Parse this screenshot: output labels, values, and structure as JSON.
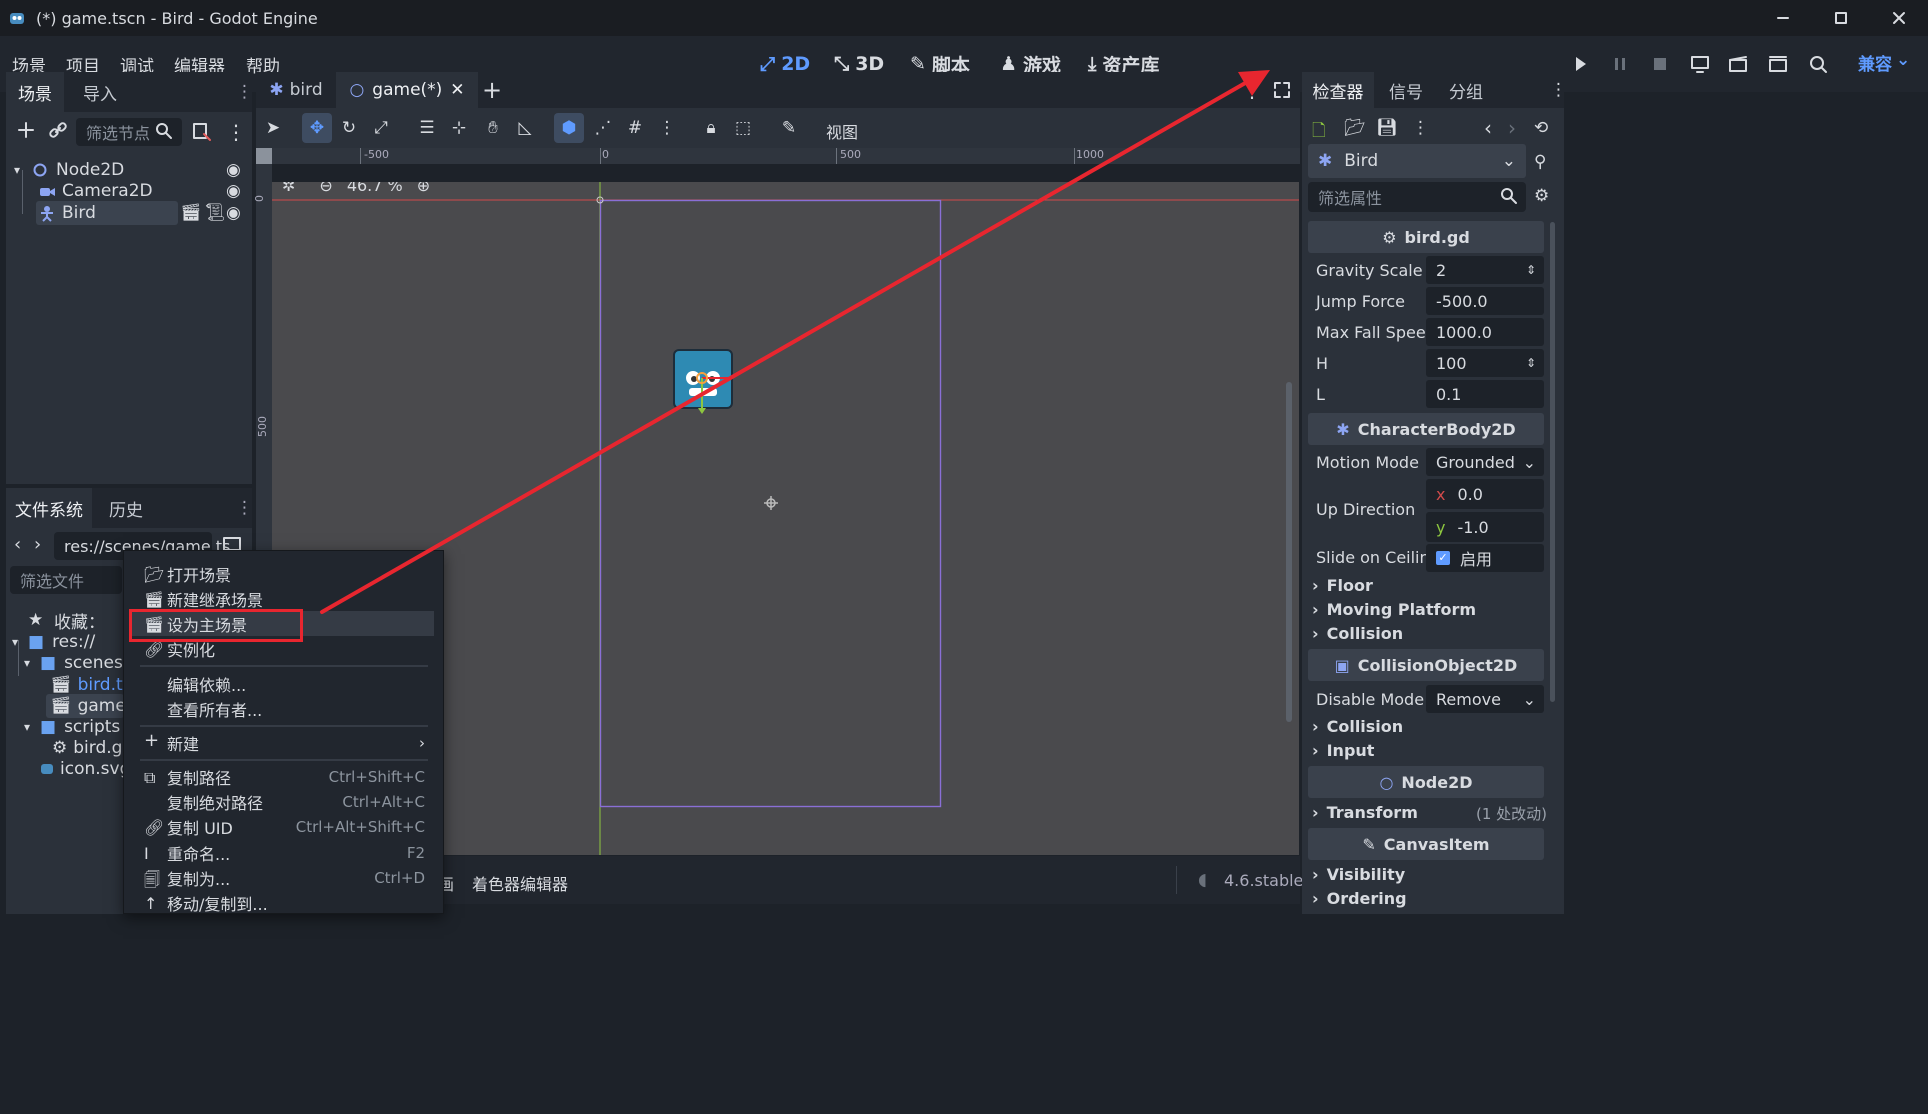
{
  "window": {
    "title": "(*) game.tscn - Bird - Godot Engine"
  },
  "menus": [
    "场景",
    "项目",
    "调试",
    "编辑器",
    "帮助"
  ],
  "workspaces": [
    {
      "label": "2D",
      "active": true
    },
    {
      "label": "3D"
    },
    {
      "label": "脚本"
    },
    {
      "label": "游戏"
    },
    {
      "label": "资产库"
    }
  ],
  "renderer": "兼容",
  "scene_dock": {
    "tabs": [
      "场景",
      "导入"
    ],
    "filter_placeholder": "筛选节点",
    "nodes": [
      {
        "name": "Node2D",
        "icon": "node2d-circle-icon"
      },
      {
        "name": "Camera2D",
        "icon": "camera-icon"
      },
      {
        "name": "Bird",
        "icon": "characterbody-icon",
        "selected": true
      }
    ]
  },
  "fs_dock": {
    "tabs": [
      "文件系统",
      "历史"
    ],
    "path": "res://scenes/game.ts",
    "filter_placeholder": "筛选文件",
    "items": [
      {
        "label": "收藏：",
        "icon": "star-icon"
      },
      {
        "label": "res://",
        "icon": "folder-icon"
      },
      {
        "label": "scenes",
        "icon": "folder-icon"
      },
      {
        "label": "bird.tscn",
        "icon": "scene-icon"
      },
      {
        "label": "game.ts",
        "icon": "scene-icon"
      },
      {
        "label": "scripts",
        "icon": "folder-icon"
      },
      {
        "label": "bird.gd",
        "icon": "gear-icon"
      },
      {
        "label": "icon.svg",
        "icon": "godot-icon"
      }
    ]
  },
  "editor_tabs": [
    {
      "label": "bird"
    },
    {
      "label": "game(*)",
      "active": true
    }
  ],
  "toolbar": {
    "view_label": "视图"
  },
  "ruler": {
    "h": [
      "-500",
      "0",
      "500",
      "1000"
    ],
    "v": [
      "0",
      "500"
    ]
  },
  "zoom": "46.7 %",
  "bottom_panel": {
    "items": [
      "画",
      "着色器编辑器"
    ],
    "version": "4.6.stable"
  },
  "inspector": {
    "tabs": [
      "检查器",
      "信号",
      "分组"
    ],
    "object": "Bird",
    "filter_placeholder": "筛选属性",
    "script_section": "bird.gd",
    "props": [
      {
        "label": "Gravity Scale",
        "value": "2",
        "spin": true
      },
      {
        "label": "Jump Force",
        "value": "-500.0"
      },
      {
        "label": "Max Fall Speed",
        "value": "1000.0"
      },
      {
        "label": "H",
        "value": "100",
        "spin": true
      },
      {
        "label": "L",
        "value": "0.1"
      }
    ],
    "cb2d": "CharacterBody2D",
    "motion_mode": {
      "label": "Motion Mode",
      "value": "Grounded"
    },
    "up_direction": {
      "label": "Up Direction",
      "x_label": "x",
      "x": "0.0",
      "y_label": "y",
      "y": "-1.0"
    },
    "slide_ceiling": {
      "label": "Slide on Ceiling",
      "value": "启用"
    },
    "groups1": [
      "Floor",
      "Moving Platform",
      "Collision"
    ],
    "co2d": "CollisionObject2D",
    "disable_mode": {
      "label": "Disable Mode",
      "value": "Remove"
    },
    "groups2": [
      "Collision",
      "Input"
    ],
    "node2d": "Node2D",
    "transform": {
      "label": "Transform",
      "note": "(1 处改动)"
    },
    "canvas": "CanvasItem",
    "groups3": [
      "Visibility",
      "Ordering"
    ]
  },
  "context_menu": [
    {
      "label": "打开场景",
      "icon": "folder-open-icon"
    },
    {
      "label": "新建继承场景",
      "icon": "scene-add-icon"
    },
    {
      "label": "设为主场景",
      "icon": "scene-icon",
      "highlight": true
    },
    {
      "label": "实例化",
      "icon": "link-icon"
    },
    {
      "sep": true
    },
    {
      "label": "编辑依赖..."
    },
    {
      "label": "查看所有者..."
    },
    {
      "sep": true
    },
    {
      "label": "新建",
      "icon": "plus-icon",
      "submenu": true
    },
    {
      "sep": true
    },
    {
      "label": "复制路径",
      "icon": "copy-icon",
      "shortcut": "Ctrl+Shift+C"
    },
    {
      "label": "复制绝对路径",
      "shortcut": "Ctrl+Alt+C"
    },
    {
      "label": "复制 UID",
      "icon": "link-icon",
      "shortcut": "Ctrl+Alt+Shift+C"
    },
    {
      "label": "重命名...",
      "icon": "cursor-icon",
      "shortcut": "F2"
    },
    {
      "label": "复制为...",
      "icon": "duplicate-icon",
      "shortcut": "Ctrl+D"
    },
    {
      "label": "移动/复制到...",
      "icon": "arrow-up-icon"
    }
  ],
  "colors": {
    "accent": "#5f9bff",
    "annotation": "#e8262f",
    "x_axis": "#d14b4b",
    "y_axis": "#8dc63f",
    "viewport_frame": "#8a6fd6"
  }
}
